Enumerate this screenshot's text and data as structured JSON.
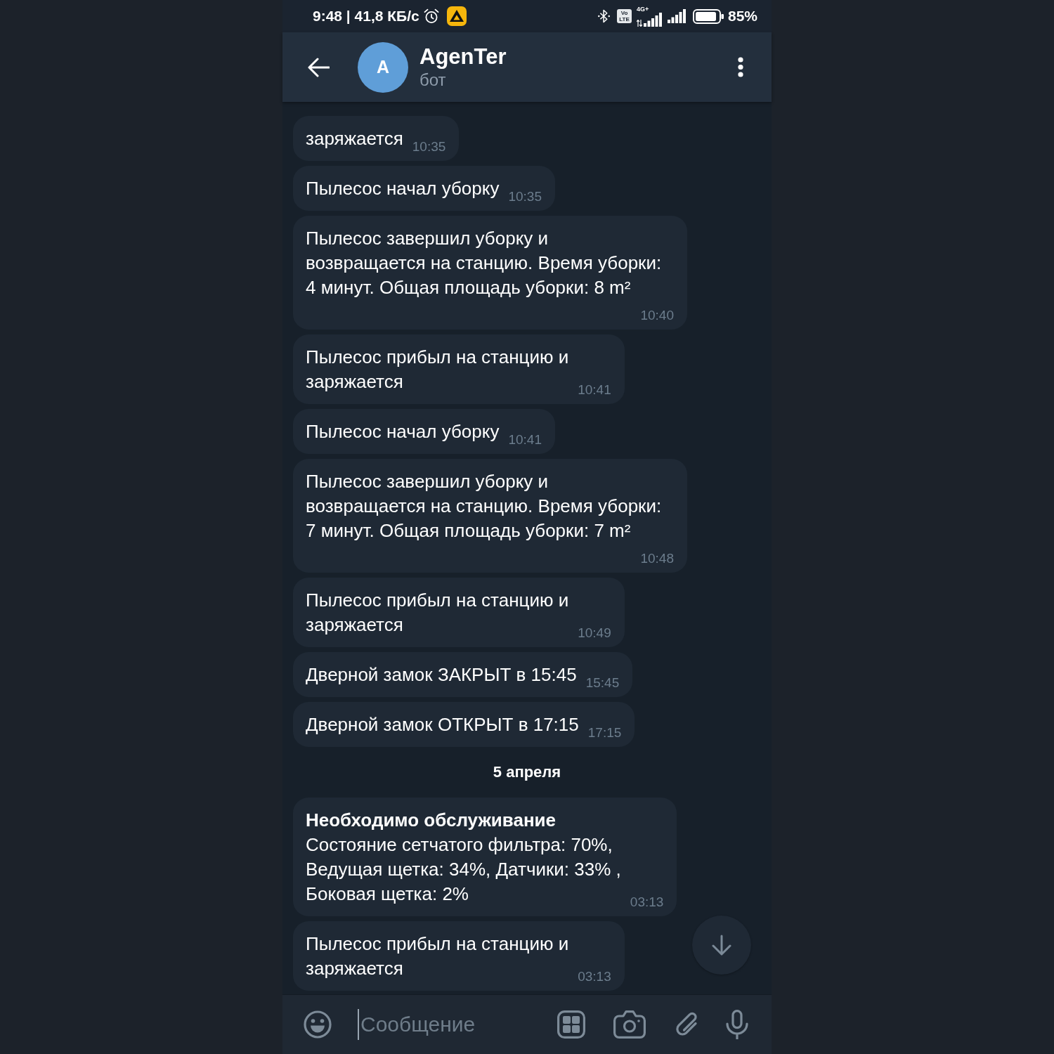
{
  "status_bar": {
    "time": "9:48 | 41,8 КБ/с",
    "lte_badge": "Vo LTE",
    "network_type": "4G+",
    "battery": "85%"
  },
  "header": {
    "avatar_letter": "A",
    "title": "AgenTer",
    "subtitle": "бот"
  },
  "messages": [
    {
      "kind": "message",
      "text": "заряжается",
      "time": "10:35"
    },
    {
      "kind": "message",
      "text": "Пылесос начал уборку",
      "time": "10:35"
    },
    {
      "kind": "message",
      "text": "Пылесос завершил уборку и\nвозвращается на станцию. Время уборки:\n4 минут. Общая площадь уборки: 8 m²",
      "time": "10:40"
    },
    {
      "kind": "message",
      "text": "Пылесос прибыл на станцию и\nзаряжается",
      "time": "10:41"
    },
    {
      "kind": "message",
      "text": "Пылесос начал уборку",
      "time": "10:41"
    },
    {
      "kind": "message",
      "text": "Пылесос завершил уборку и\nвозвращается на станцию. Время уборки:\n7 минут. Общая площадь уборки: 7 m²",
      "time": "10:48"
    },
    {
      "kind": "message",
      "text": "Пылесос прибыл на станцию и\nзаряжается",
      "time": "10:49"
    },
    {
      "kind": "message",
      "text": "Дверной замок ЗАКРЫТ в 15:45",
      "time": "15:45"
    },
    {
      "kind": "message",
      "text": "Дверной замок ОТКРЫТ в 17:15",
      "time": "17:15"
    },
    {
      "kind": "date",
      "text": "5 апреля"
    },
    {
      "kind": "message",
      "title": "Необходимо обслуживание",
      "text": "Состояние сетчатого фильтра: 70%,\nВедущая щетка: 34%, Датчики: 33% ,\nБоковая щетка: 2%",
      "time": "03:13"
    },
    {
      "kind": "message",
      "text": "Пылесос прибыл на станцию и\nзаряжается",
      "time": "03:13"
    }
  ],
  "input": {
    "placeholder": "Сообщение"
  }
}
